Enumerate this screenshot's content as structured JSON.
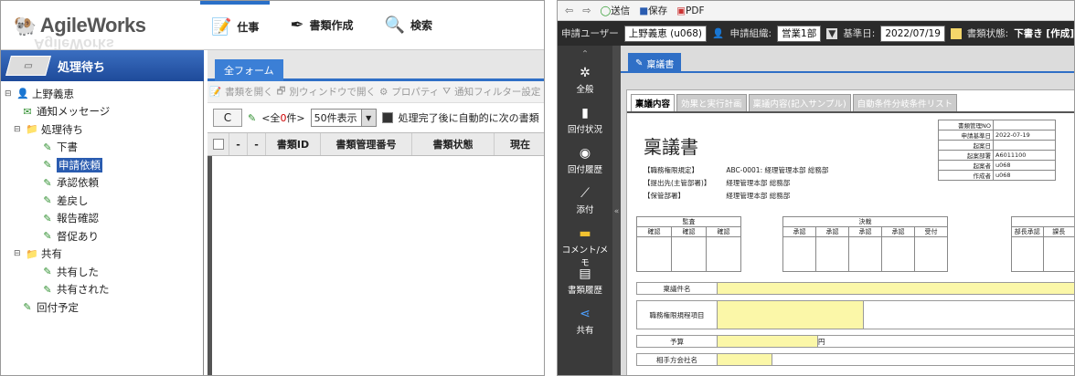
{
  "left": {
    "logo": "AgileWorks",
    "topnav": [
      {
        "label": "仕事",
        "icon": "pencil-task-icon"
      },
      {
        "label": "書類作成",
        "icon": "pen-icon"
      },
      {
        "label": "検索",
        "icon": "magnifier-icon"
      }
    ],
    "section_title": "処理待ち",
    "tab_label": "全フォーム",
    "tree": [
      {
        "label": "上野義恵",
        "level": 0,
        "icon": "user-icon"
      },
      {
        "label": "通知メッセージ",
        "level": 1,
        "icon": "message-icon"
      },
      {
        "label": "処理待ち",
        "level": 1,
        "icon": "folder-icon"
      },
      {
        "label": "下書",
        "level": 2,
        "icon": "doc-pen-icon"
      },
      {
        "label": "申請依頼",
        "level": 2,
        "icon": "doc-pen-icon",
        "selected": true
      },
      {
        "label": "承認依頼",
        "level": 2,
        "icon": "doc-pen-icon"
      },
      {
        "label": "差戻し",
        "level": 2,
        "icon": "doc-pen-icon"
      },
      {
        "label": "報告確認",
        "level": 2,
        "icon": "doc-pen-icon"
      },
      {
        "label": "督促あり",
        "level": 2,
        "icon": "doc-pen-icon"
      },
      {
        "label": "共有",
        "level": 1,
        "icon": "folder-icon"
      },
      {
        "label": "共有した",
        "level": 2,
        "icon": "doc-pen-icon"
      },
      {
        "label": "共有された",
        "level": 2,
        "icon": "doc-pen-icon"
      },
      {
        "label": "回付予定",
        "level": 1,
        "icon": "doc-pen-icon"
      }
    ],
    "toolbar": [
      "書類を開く",
      "別ウィンドウで開く",
      "プロパティ",
      "通知フィルター設定"
    ],
    "pager": {
      "refresh": "C",
      "prev": "<全",
      "count": "0",
      "unit": "件>",
      "per_page": "50件表示",
      "auto_label": "処理完了後に自動的に次の書類"
    },
    "columns": [
      "-",
      "-",
      "書類ID",
      "書類管理番号",
      "書類状態",
      "現在"
    ]
  },
  "right": {
    "toolbar": [
      {
        "label": "",
        "icon": "back-icon"
      },
      {
        "label": "",
        "icon": "forward-icon"
      },
      {
        "label": "送信",
        "icon": "send-icon"
      },
      {
        "label": "保存",
        "icon": "save-icon"
      },
      {
        "label": "PDF",
        "icon": "pdf-icon"
      }
    ],
    "userbar": {
      "applicant_label": "申請ユーザー",
      "applicant_value": "上野義恵 (u068)",
      "org_label": "申請組織:",
      "org_value": "営業1部",
      "date_label": "基準日:",
      "date_value": "2022/07/19",
      "status_label": "書類状態:",
      "status_value": "下書き [作成]"
    },
    "sidebar": [
      {
        "label": "全般",
        "icon": "gear-icon"
      },
      {
        "label": "回付状況",
        "icon": "route-icon"
      },
      {
        "label": "回付履歴",
        "icon": "history-icon"
      },
      {
        "label": "添付",
        "icon": "clip-icon"
      },
      {
        "label": "コメント/メモ",
        "icon": "comment-icon"
      },
      {
        "label": "書類履歴",
        "icon": "doc-history-icon"
      },
      {
        "label": "共有",
        "icon": "share-icon"
      }
    ],
    "doc_tab": "稟議書",
    "sheet_tabs": [
      "稟議内容",
      "効果と実行計画",
      "稟議内容(記入サンプル)",
      "自動条件分岐条件リスト"
    ],
    "form_title": "稟議書",
    "kv": [
      {
        "k": "【職務権限規定】",
        "v": "ABC-0001: 経理管理本部 総務部"
      },
      {
        "k": "【提出先(主管部署)】",
        "v": "経理管理本部 総務部"
      },
      {
        "k": "【保管部署】",
        "v": "経理管理本部 総務部"
      }
    ],
    "meta": [
      {
        "k": "書類管理NO",
        "v": ""
      },
      {
        "k": "申請基準日",
        "v": "2022-07-19"
      },
      {
        "k": "起案日",
        "v": ""
      },
      {
        "k": "起案部署",
        "v": "A6011100"
      },
      {
        "k": "起案者",
        "v": "u068"
      },
      {
        "k": "作成者",
        "v": "u068"
      }
    ],
    "approval_groups": [
      {
        "title": "監査",
        "cols": [
          "確認",
          "確認",
          "確認"
        ]
      },
      {
        "title": "決裁",
        "cols": [
          "承認",
          "承認",
          "承認",
          "承認",
          "受付"
        ]
      },
      {
        "title": "",
        "cols": [
          "部長承認",
          "課長"
        ]
      }
    ],
    "fields": [
      {
        "label": "稟議件名",
        "extra": ""
      },
      {
        "label": "職務権限規程項目",
        "extra": ""
      },
      {
        "label": "予算",
        "extra": "円"
      },
      {
        "label": "相手方会社名",
        "extra": ""
      }
    ],
    "collapse": "«",
    "colors": {
      "accent": "#2f6fc6",
      "dark": "#2b2b2b",
      "field_yellow": "#fbf7a8"
    }
  }
}
